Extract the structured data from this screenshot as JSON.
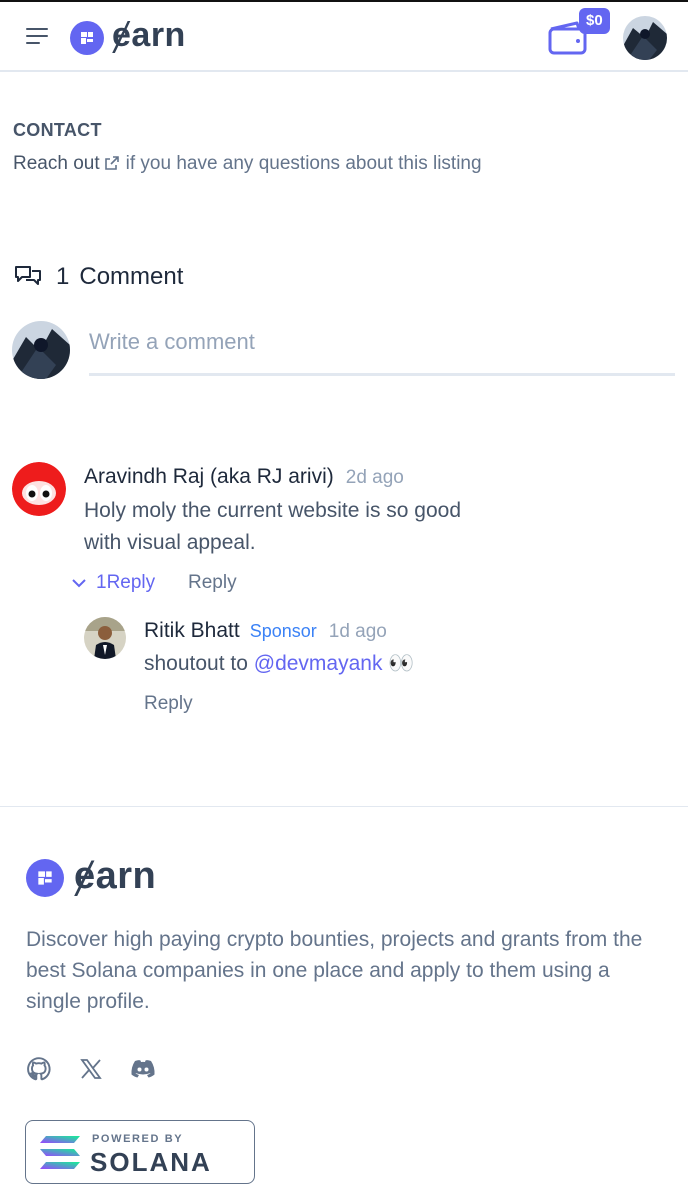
{
  "header": {
    "logo_text": "ɇarn",
    "wallet_amount": "$0"
  },
  "contact": {
    "title": "CONTACT",
    "reach_out": "Reach out",
    "rest": "if you have any questions about this listing"
  },
  "comments": {
    "count": "1",
    "label": "Comment",
    "input_placeholder": "Write a comment",
    "items": [
      {
        "author": "Aravindh Raj (aka RJ arivi)",
        "ago": "2d ago",
        "text": "Holy moly the current website is so good with visual appeal.",
        "replies_toggle": "1Reply",
        "reply_label": "Reply",
        "replies": [
          {
            "author": "Ritik Bhatt",
            "badge": "Sponsor",
            "ago": "1d ago",
            "text_prefix": "shoutout to ",
            "mention": "@devmayank",
            "emoji": "👀",
            "reply_label": "Reply"
          }
        ]
      }
    ]
  },
  "footer": {
    "logo_text": "ɇarn",
    "description": "Discover high paying crypto bounties, projects and grants from the best Solana companies in one place and apply to them using a single profile.",
    "socials": [
      "github-icon",
      "x-icon",
      "discord-icon"
    ],
    "powered_by": "POWERED BY",
    "solana": "SOLANA"
  },
  "colors": {
    "accent": "#6366f1",
    "sponsor": "#3b82f6",
    "muted": "#64748b"
  }
}
